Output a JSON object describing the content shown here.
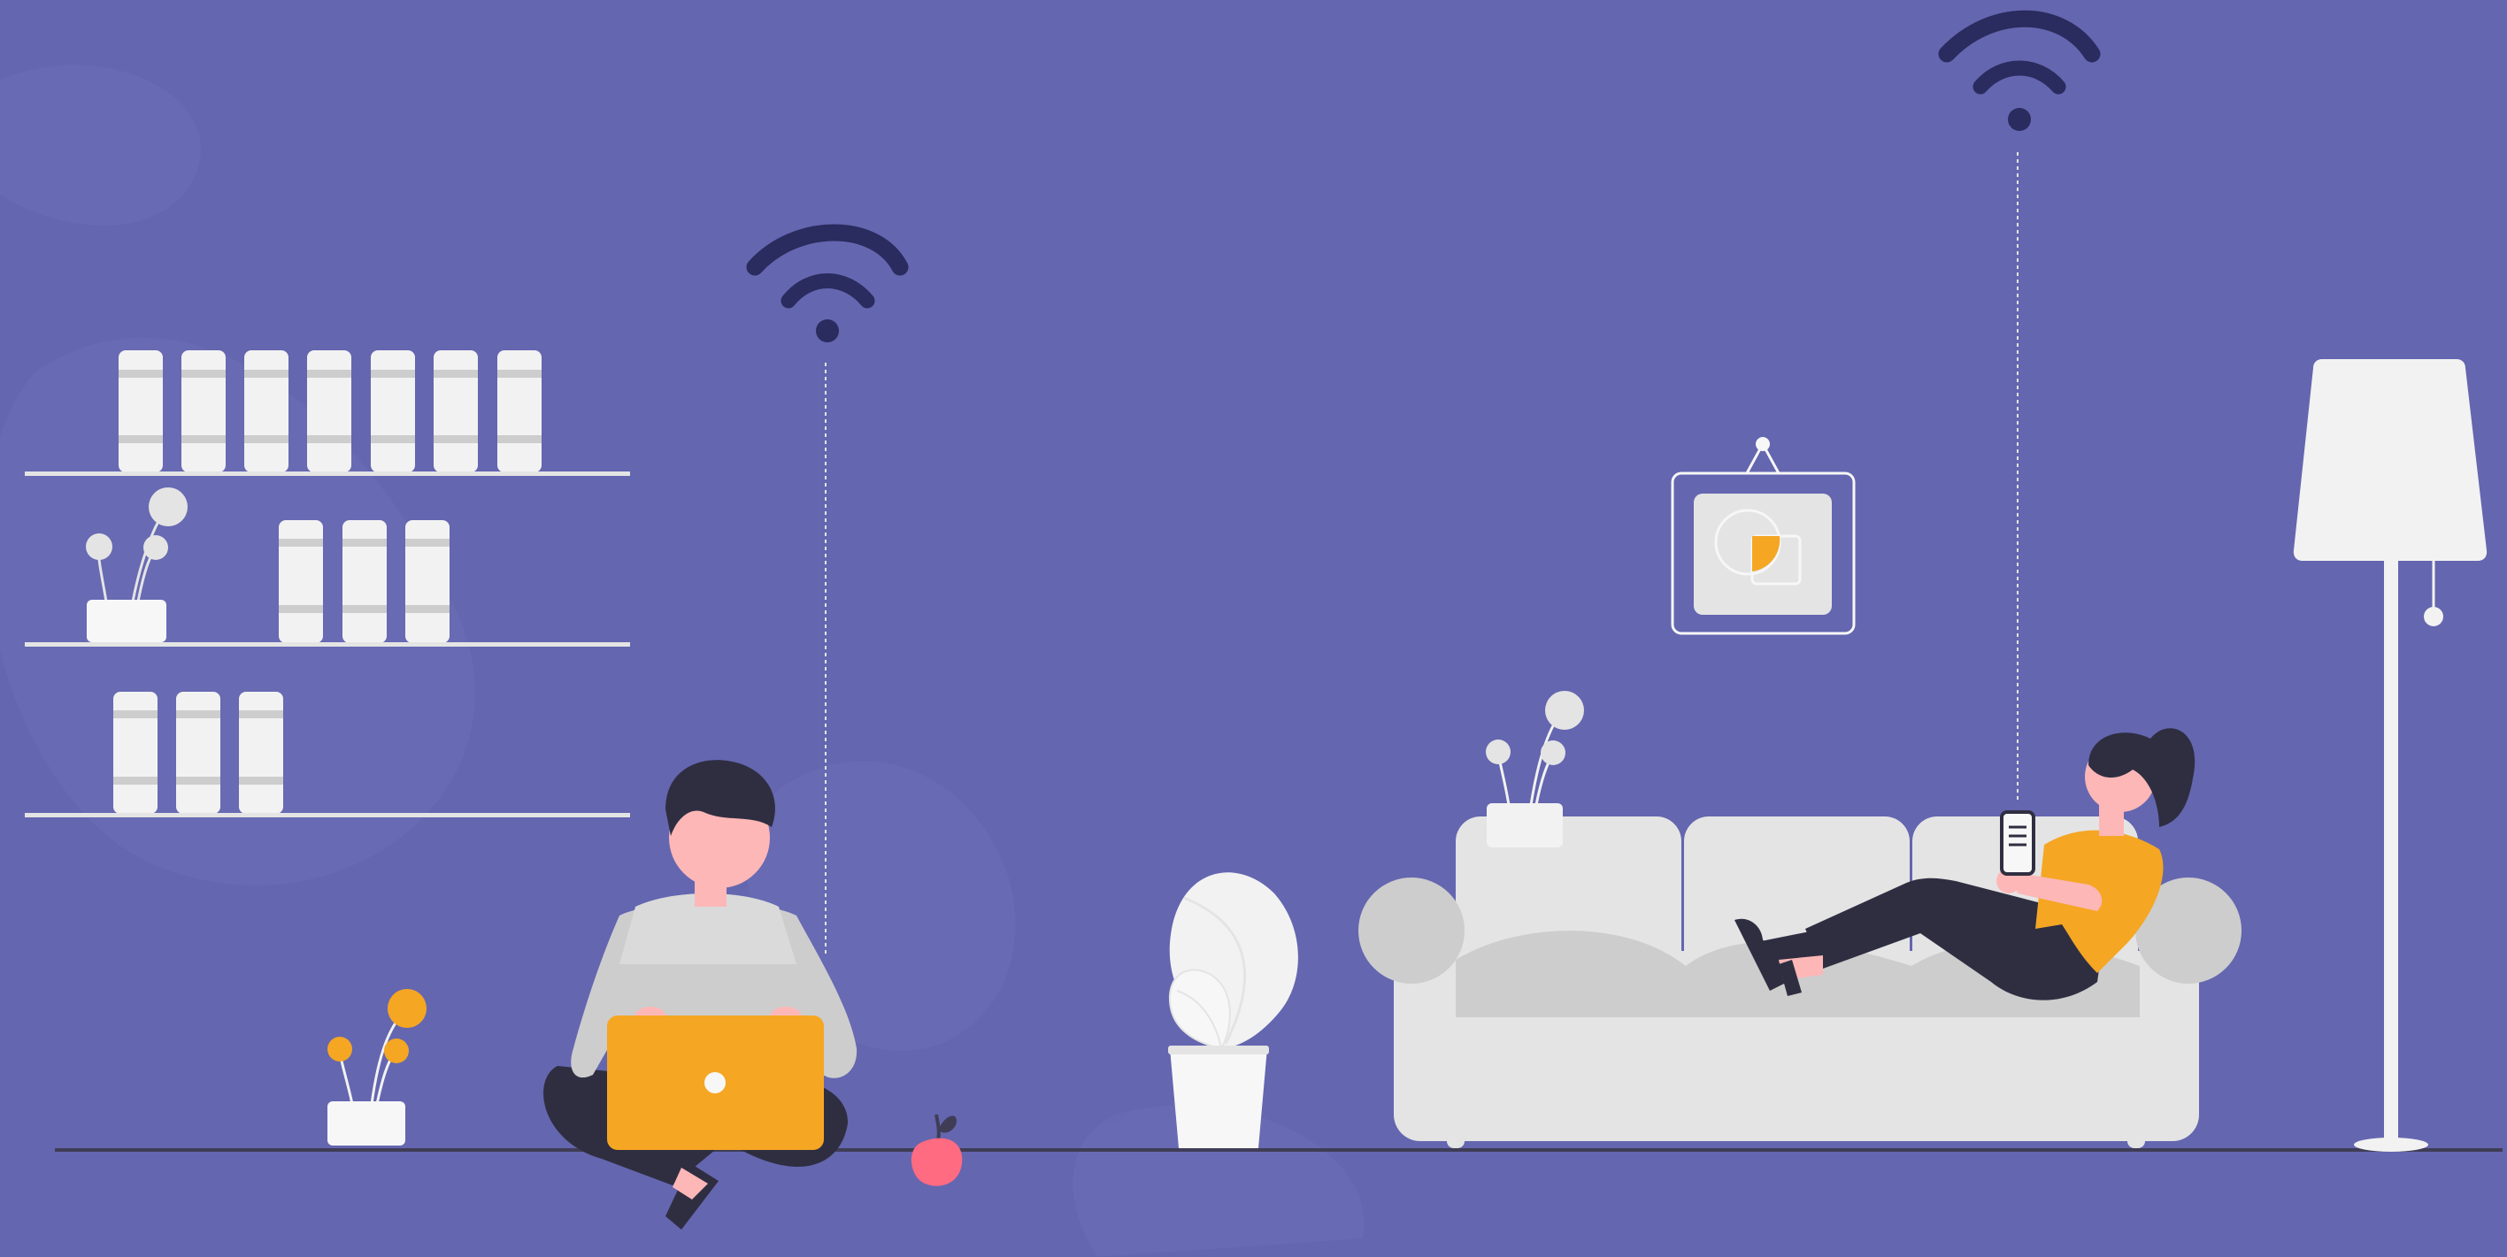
{
  "scene": {
    "description_text": "",
    "colors": {
      "background": "#6466B0",
      "background_blob": "#6B6DB6",
      "wifi": "#2A2B5E",
      "furniture_light": "#E4E4E4",
      "furniture_mid": "#CDCDCD",
      "accent_orange": "#F5A623",
      "skin": "#FDB7B7",
      "hair_pants": "#2F2E41",
      "apple": "#FF6B81",
      "floor_line": "#3F3D56",
      "white": "#F7F7F7"
    },
    "icons": [
      "wifi-icon",
      "wifi-icon",
      "chart-icon"
    ]
  }
}
